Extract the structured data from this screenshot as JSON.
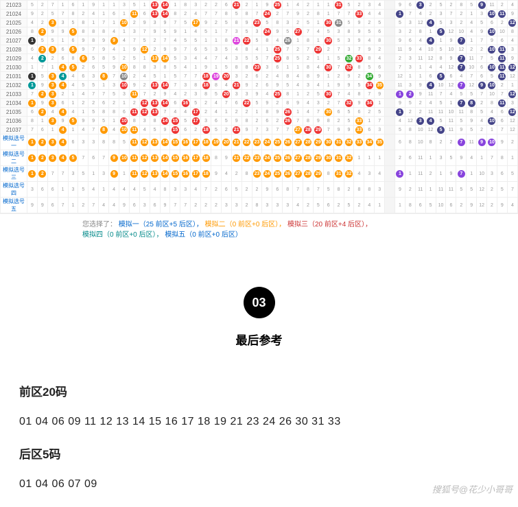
{
  "table": {
    "row_ids": [
      "21023",
      "21024",
      "21025",
      "21026",
      "21027",
      "21028",
      "21029",
      "21030",
      "21031",
      "21032",
      "21033",
      "21034",
      "21035",
      "21036",
      "21037"
    ],
    "sim_labels": [
      "模拟选号一",
      "模拟选号二",
      "模拟选号三",
      "模拟选号四",
      "模拟选号五"
    ],
    "cols_front": 35,
    "cols_back": 12,
    "rows": [
      {
        "id": "21023",
        "balls": {
          "13": "red",
          "14": "red",
          "21": "red",
          "25": "red",
          "31": "red"
        },
        "back": {
          "3": "navy",
          "9": "navy"
        }
      },
      {
        "id": "21024",
        "balls": {
          "11": "orange",
          "13": "red",
          "14": "red",
          "24": "red",
          "33": "red"
        },
        "back": {
          "1": "navy",
          "10": "navy",
          "11": "navy"
        }
      },
      {
        "id": "21025",
        "balls": {
          "3": "orange",
          "10": "orange",
          "17": "orange",
          "23": "red",
          "30": "red",
          "31": "gray"
        },
        "back": {
          "4": "navy",
          "12": "navy"
        }
      },
      {
        "id": "21026",
        "balls": {
          "2": "orange",
          "5": "orange",
          "24": "red",
          "27": "red"
        },
        "back": {
          "5": "navy",
          "10": "navy"
        }
      },
      {
        "id": "21027",
        "balls": {
          "1": "dark",
          "9": "orange",
          "21": "pink",
          "22": "red",
          "26": "gray",
          "30": "red"
        },
        "back": {
          "4": "navy",
          "7": "navy"
        }
      },
      {
        "id": "21028",
        "balls": {
          "2": "orange",
          "3": "orange",
          "5": "orange",
          "12": "orange",
          "25": "red",
          "29": "red"
        },
        "back": {
          "11": "navy",
          "15": "navy",
          "10": "navy"
        }
      },
      {
        "id": "21029",
        "balls": {
          "2": "teal",
          "6": "orange",
          "13": "orange",
          "14": "orange",
          "25": "red",
          "32": "green",
          "33": "red"
        },
        "back": {
          "7": "navy",
          "15": "navy",
          "11": "navy"
        }
      },
      {
        "id": "21030",
        "balls": {
          "4": "orange",
          "5": "orange",
          "10": "orange",
          "23": "red",
          "30": "red",
          "32": "red"
        },
        "back": {
          "12": "navy",
          "10": "navy",
          "7": "navy",
          "11": "navy"
        }
      },
      {
        "id": "21031",
        "balls": {
          "1": "dark",
          "3": "orange",
          "4": "teal",
          "8": "orange",
          "18": "red",
          "19": "pink",
          "20": "red",
          "34": "green",
          "10": "gray"
        },
        "back": {
          "5": "navy",
          "11": "navy"
        }
      },
      {
        "id": "21032",
        "balls": {
          "1": "teal",
          "3": "orange",
          "4": "orange",
          "10": "red",
          "13": "red",
          "14": "red",
          "18": "red",
          "21": "red",
          "34": "red",
          "35": "orange"
        },
        "back": {
          "4": "navy",
          "7": "purple",
          "9": "navy",
          "10": "navy"
        }
      },
      {
        "id": "21033",
        "balls": {
          "2": "orange",
          "3": "orange",
          "11": "orange",
          "20": "red",
          "25": "red",
          "30": "red"
        },
        "back": {
          "1": "purple",
          "2": "purple",
          "12": "navy"
        }
      },
      {
        "id": "21034",
        "balls": {
          "1": "orange",
          "3": "orange",
          "12": "red",
          "13": "red",
          "14": "red",
          "16": "red",
          "22": "red",
          "32": "red",
          "34": "red"
        },
        "back": {
          "7": "navy",
          "8": "navy",
          "11": "navy"
        }
      },
      {
        "id": "21035",
        "balls": {
          "2": "orange",
          "4": "orange",
          "11": "red",
          "12": "red",
          "13": "red",
          "17": "red",
          "26": "red",
          "30": "orange"
        },
        "back": {
          "1": "navy",
          "12": "navy"
        }
      },
      {
        "id": "21036",
        "balls": {
          "3": "orange",
          "5": "orange",
          "10": "red",
          "14": "red",
          "15": "red",
          "17": "red",
          "26": "red",
          "33": "orange"
        },
        "back": {
          "10": "navy",
          "13": "navy",
          "4": "navy",
          "3": "navy"
        }
      },
      {
        "id": "21037",
        "balls": {
          "4": "orange",
          "8": "orange",
          "10": "orange",
          "11": "orange",
          "15": "red",
          "21": "red",
          "18": "red",
          "27": "orange",
          "28": "red",
          "29": "red",
          "33": "orange"
        },
        "back": {
          "14": "navy",
          "5": "navy"
        }
      }
    ],
    "sim_rows": [
      {
        "label": "模拟选号一",
        "balls": {
          "1": "orange",
          "2": "orange",
          "3": "orange",
          "4": "orange",
          "11": "orange",
          "12": "orange",
          "13": "orange",
          "14": "orange",
          "15": "orange",
          "16": "orange",
          "17": "orange",
          "18": "orange",
          "19": "orange",
          "20": "orange",
          "21": "orange",
          "22": "orange",
          "23": "orange",
          "24": "orange",
          "25": "orange",
          "26": "orange",
          "27": "orange",
          "28": "orange",
          "29": "orange",
          "30": "orange",
          "31": "orange",
          "32": "orange",
          "33": "orange",
          "34": "orange",
          "35": "orange"
        },
        "back": {
          "7": "purple",
          "9": "purple",
          "10": "purple"
        }
      },
      {
        "label": "模拟选号二",
        "balls": {
          "1": "orange",
          "2": "orange",
          "3": "orange",
          "4": "orange",
          "5": "orange",
          "9": "orange",
          "10": "orange",
          "11": "orange",
          "12": "orange",
          "13": "orange",
          "14": "orange",
          "15": "orange",
          "16": "orange",
          "17": "orange",
          "18": "orange",
          "21": "orange",
          "22": "orange",
          "23": "orange",
          "24": "orange",
          "25": "orange",
          "26": "orange",
          "27": "orange",
          "28": "orange",
          "29": "orange",
          "30": "orange",
          "31": "orange",
          "32": "orange"
        },
        "back": {}
      },
      {
        "label": "模拟选号三",
        "balls": {
          "1": "orange",
          "2": "orange",
          "9": "orange",
          "11": "orange",
          "12": "orange",
          "13": "orange",
          "14": "orange",
          "15": "orange",
          "16": "orange",
          "17": "orange",
          "18": "orange",
          "23": "orange",
          "24": "orange",
          "25": "orange",
          "26": "orange",
          "27": "orange",
          "28": "orange",
          "29": "orange",
          "31": "orange",
          "32": "orange"
        },
        "back": {
          "1": "purple",
          "7": "purple"
        }
      },
      {
        "label": "模拟选号四",
        "balls": {},
        "back": {}
      },
      {
        "label": "模拟选号五",
        "balls": {},
        "back": {}
      }
    ]
  },
  "footer_note": {
    "prefix": "您选择了：",
    "items": [
      "模拟一（25 前区+5 后区），",
      "模拟二（0 前区+0 后区），",
      "模拟三（20 前区+4 后区），",
      "模拟四（0 前区+0 后区），",
      "模拟五（0 前区+0 后区）"
    ]
  },
  "section": {
    "badge": "03",
    "title": "最后参考",
    "front_heading": "前区20码",
    "front_numbers": "01 04 06 09 11 12 13 14 15 16 17 18 19 21 23 24 26 30 31 33",
    "back_heading": "后区5码",
    "back_numbers": "01 04 06 07 09"
  },
  "watermark": "搜狐号@花少小哥哥"
}
